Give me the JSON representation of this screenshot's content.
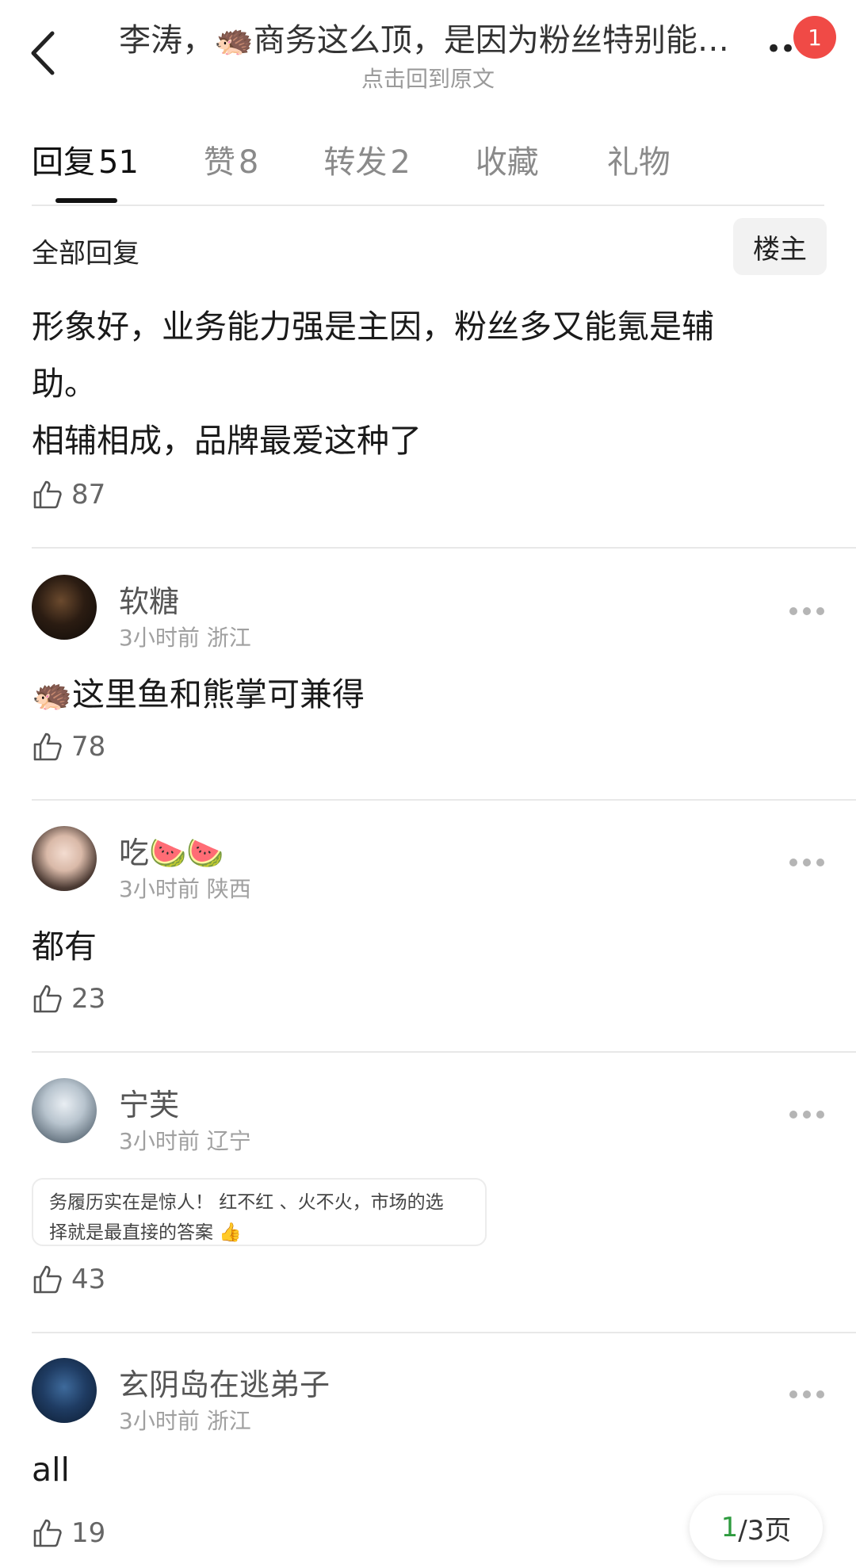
{
  "header": {
    "title": "李涛，🦔商务这么顶，是因为粉丝特别能…",
    "subtitle": "点击回到原文",
    "notification_count": "1"
  },
  "tabs": [
    {
      "label": "回复",
      "count": "51",
      "active": true
    },
    {
      "label": "赞",
      "count": "8"
    },
    {
      "label": "转发",
      "count": "2"
    },
    {
      "label": "收藏",
      "count": ""
    },
    {
      "label": "礼物",
      "count": ""
    }
  ],
  "section": {
    "all_replies": "全部回复",
    "owner_button": "楼主"
  },
  "main_post": {
    "lines": [
      "形象好，业务能力强是主因，粉丝多又能氪是辅",
      "助。",
      "相辅相成，品牌最爱这种了"
    ],
    "likes": "87"
  },
  "comments": [
    {
      "user": "软糖",
      "time": "3小时前",
      "location": "浙江",
      "text": "🦔这里鱼和熊掌可兼得",
      "likes": "78"
    },
    {
      "user": "吃🍉🍉",
      "time": "3小时前",
      "location": "陕西",
      "text": "都有",
      "likes": "23"
    },
    {
      "user": "宁芙",
      "time": "3小时前",
      "location": "辽宁",
      "quote": [
        "务履历实在是惊人！ 红不红 、火不火，市场的选",
        "择就是最直接的答案 👍"
      ],
      "likes": "43"
    },
    {
      "user": "玄阴岛在逃弟子",
      "time": "3小时前",
      "location": "浙江",
      "text": "all",
      "likes": "19"
    }
  ],
  "pager": {
    "current": "1",
    "total_text": "/3页"
  },
  "icons": [
    "back-arrow-icon",
    "more-icon",
    "thumbs-up-icon",
    "ellipsis-icon"
  ]
}
